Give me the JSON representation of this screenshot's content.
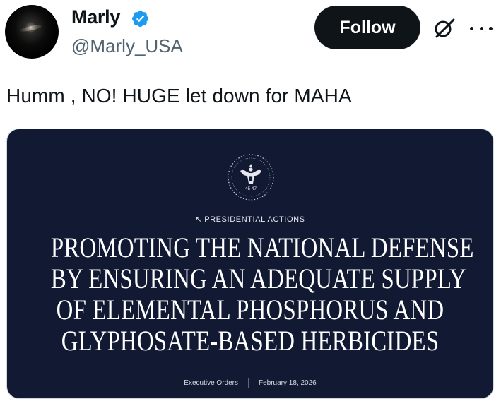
{
  "user": {
    "display_name": "Marly",
    "handle": "@Marly_USA",
    "verified": true,
    "verified_color": "#1d9bf0"
  },
  "actions": {
    "follow_label": "Follow",
    "grok_icon": "grok-icon",
    "more_icon": "more-icon"
  },
  "tweet": {
    "text": "Humm , NO! HUGE let down for MAHA"
  },
  "media": {
    "background_color": "#121a33",
    "seal_text": "45 47",
    "kicker": "PRESIDENTIAL ACTIONS",
    "headline_lines": [
      "PROMOTING THE NATIONAL DEFENSE",
      "BY ENSURING AN ADEQUATE SUPPLY",
      "OF ELEMENTAL PHOSPHORUS AND",
      "GLYPHOSATE-BASED HERBICIDES"
    ],
    "category": "Executive Orders",
    "date": "February 18, 2026"
  }
}
